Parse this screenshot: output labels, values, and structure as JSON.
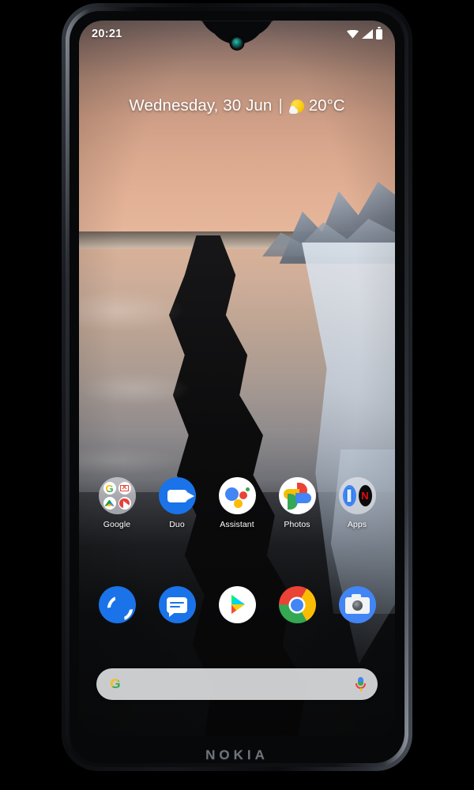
{
  "device": {
    "brand": "NOKIA",
    "notch": "waterdrop-notch",
    "camera": "front-camera"
  },
  "status_bar": {
    "time": "20:21",
    "icons": [
      "wifi-icon",
      "signal-icon",
      "battery-icon"
    ]
  },
  "widget": {
    "date": "Wednesday, 30 Jun",
    "separator": "|",
    "weather_icon": "sun-behind-cloud-icon",
    "temperature": "20°C"
  },
  "home_row": [
    {
      "label": "Google",
      "icon": "google-folder-icon",
      "type": "folder"
    },
    {
      "label": "Duo",
      "icon": "duo-icon",
      "type": "app"
    },
    {
      "label": "Assistant",
      "icon": "google-assistant-icon",
      "type": "app"
    },
    {
      "label": "Photos",
      "icon": "google-photos-icon",
      "type": "app"
    },
    {
      "label": "Apps",
      "icon": "apps-folder-icon",
      "type": "folder"
    }
  ],
  "dock": [
    {
      "label": "Phone",
      "icon": "phone-icon"
    },
    {
      "label": "Messages",
      "icon": "messages-icon"
    },
    {
      "label": "Play Store",
      "icon": "play-store-icon"
    },
    {
      "label": "Chrome",
      "icon": "chrome-icon"
    },
    {
      "label": "Camera",
      "icon": "camera-icon"
    }
  ],
  "search": {
    "placeholder": "",
    "value": "",
    "left_icon": "google-g-icon",
    "right_icon": "microphone-icon"
  },
  "colors": {
    "google_blue": "#4285f4",
    "google_red": "#ea4335",
    "google_yellow": "#fbbc05",
    "google_green": "#34a853",
    "netflix_red": "#e50914",
    "nokia_gray": "#6f747b",
    "accent": "#1a73e8"
  }
}
